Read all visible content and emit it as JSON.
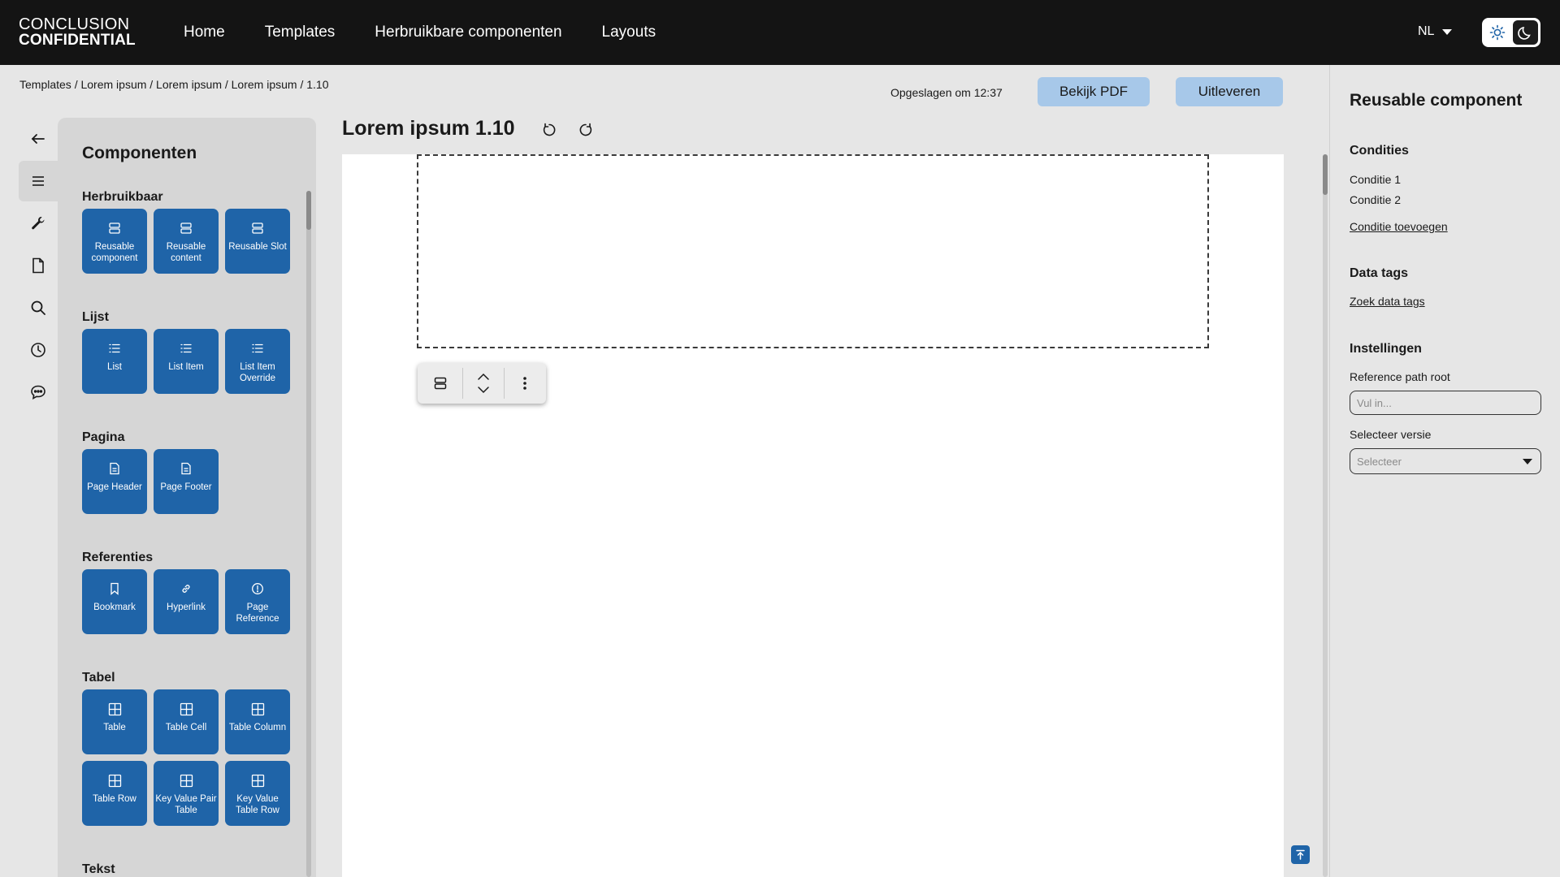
{
  "logo": {
    "line1": "CONCLUSION",
    "line2": "CONFIDENTIAL"
  },
  "nav": {
    "items": [
      "Home",
      "Templates",
      "Herbruikbare componenten",
      "Layouts"
    ]
  },
  "lang": "NL",
  "theme_icons": [
    "sun-icon",
    "moon-icon"
  ],
  "breadcrumb": "Templates / Lorem ipsum / Lorem ipsum / Lorem ipsum / 1.10",
  "toolbar": {
    "saved": "Opgeslagen om 12:37",
    "pdf": "Bekijk PDF",
    "deliver": "Uitleveren"
  },
  "rail_icons": [
    "arrow-left-icon",
    "menu-icon",
    "wrench-icon",
    "document-icon",
    "search-icon",
    "clock-icon",
    "chat-icon"
  ],
  "components": {
    "title": "Componenten",
    "sections": [
      {
        "title": "Herbruikbaar",
        "items": [
          {
            "label": "Reusable component",
            "icon": "reusable-icon"
          },
          {
            "label": "Reusable content",
            "icon": "reusable-icon"
          },
          {
            "label": "Reusable Slot",
            "icon": "reusable-icon"
          }
        ]
      },
      {
        "title": "Lijst",
        "items": [
          {
            "label": "List",
            "icon": "list-icon"
          },
          {
            "label": "List Item",
            "icon": "list-icon"
          },
          {
            "label": "List Item Override",
            "icon": "list-icon"
          }
        ]
      },
      {
        "title": "Pagina",
        "items": [
          {
            "label": "Page Header",
            "icon": "page-icon"
          },
          {
            "label": "Page Footer",
            "icon": "page-icon"
          }
        ]
      },
      {
        "title": "Referenties",
        "items": [
          {
            "label": "Bookmark",
            "icon": "bookmark-icon"
          },
          {
            "label": "Hyperlink",
            "icon": "link-icon"
          },
          {
            "label": "Page Reference",
            "icon": "info-icon"
          }
        ]
      },
      {
        "title": "Tabel",
        "items": [
          {
            "label": "Table",
            "icon": "table-icon"
          },
          {
            "label": "Table Cell",
            "icon": "table-icon"
          },
          {
            "label": "Table Column",
            "icon": "table-icon"
          },
          {
            "label": "Table Row",
            "icon": "table-icon"
          },
          {
            "label": "Key Value Pair Table",
            "icon": "table-icon"
          },
          {
            "label": "Key Value Table Row",
            "icon": "table-icon"
          }
        ]
      },
      {
        "title": "Tekst",
        "items": []
      }
    ]
  },
  "canvas": {
    "title": "Lorem ipsum 1.10"
  },
  "right": {
    "title": "Reusable component",
    "conditions": {
      "heading": "Condities",
      "items": [
        "Conditie 1",
        "Conditie 2"
      ],
      "add": "Conditie toevoegen"
    },
    "datatags": {
      "heading": "Data tags",
      "search": "Zoek data tags"
    },
    "settings": {
      "heading": "Instellingen",
      "ref_label": "Reference path root",
      "ref_placeholder": "Vul in...",
      "version_label": "Selecteer versie",
      "version_placeholder": "Selecteer"
    }
  },
  "colors": {
    "topbar": "#141414",
    "tile": "#1f64a8",
    "button": "#a7c8e9",
    "panel": "#d6d6d6",
    "background": "#e6e6e6"
  }
}
